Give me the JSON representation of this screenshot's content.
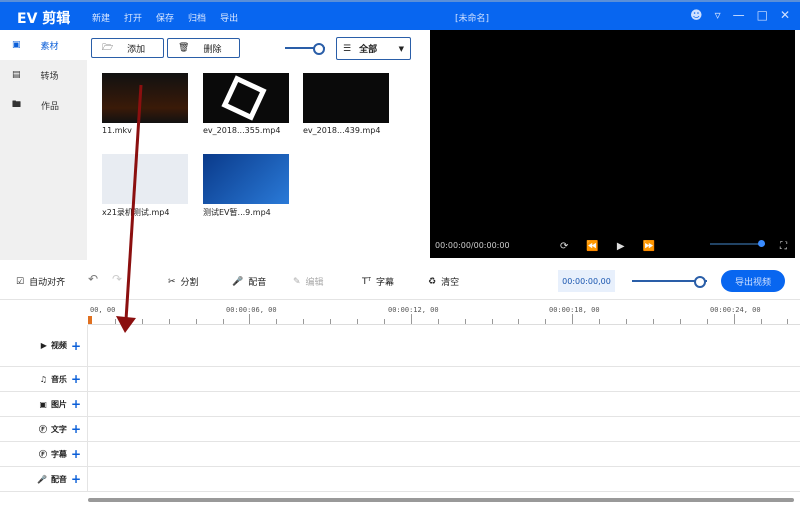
{
  "titlebar": {
    "app": "EV 剪辑",
    "menu": [
      "新建",
      "打开",
      "保存",
      "归档",
      "导出"
    ],
    "document": "[未命名]"
  },
  "sidebar": [
    {
      "icon": "grid-icon",
      "label": "素材"
    },
    {
      "icon": "transition-icon",
      "label": "转场"
    },
    {
      "icon": "folder-icon",
      "label": "作品"
    }
  ],
  "media": {
    "add": "添加",
    "delete": "删除",
    "filter": "全部",
    "items": [
      "11.mkv",
      "ev_2018...355.mp4",
      "ev_2018...439.mp4",
      "x21录机测试.mp4",
      "测试EV暂...9.mp4"
    ]
  },
  "preview": {
    "time": "00:00:00/00:00:00"
  },
  "toolbar": {
    "auto_align": "自动对齐",
    "split": "分割",
    "dub": "配音",
    "edit": "编辑",
    "subtitle": "字幕",
    "clear": "清空",
    "timecode": "00:00:00,00",
    "export": "导出视频"
  },
  "ruler": [
    "00, 00",
    "00:00:06, 00",
    "00:00:12, 00",
    "00:00:18, 00",
    "00:00:24, 00"
  ],
  "tracks": [
    "视频",
    "音乐",
    "图片",
    "文字",
    "字幕",
    "配音"
  ],
  "colors": {
    "accent": "#0866f0",
    "annotation_arrow": "#8b0f0f"
  }
}
